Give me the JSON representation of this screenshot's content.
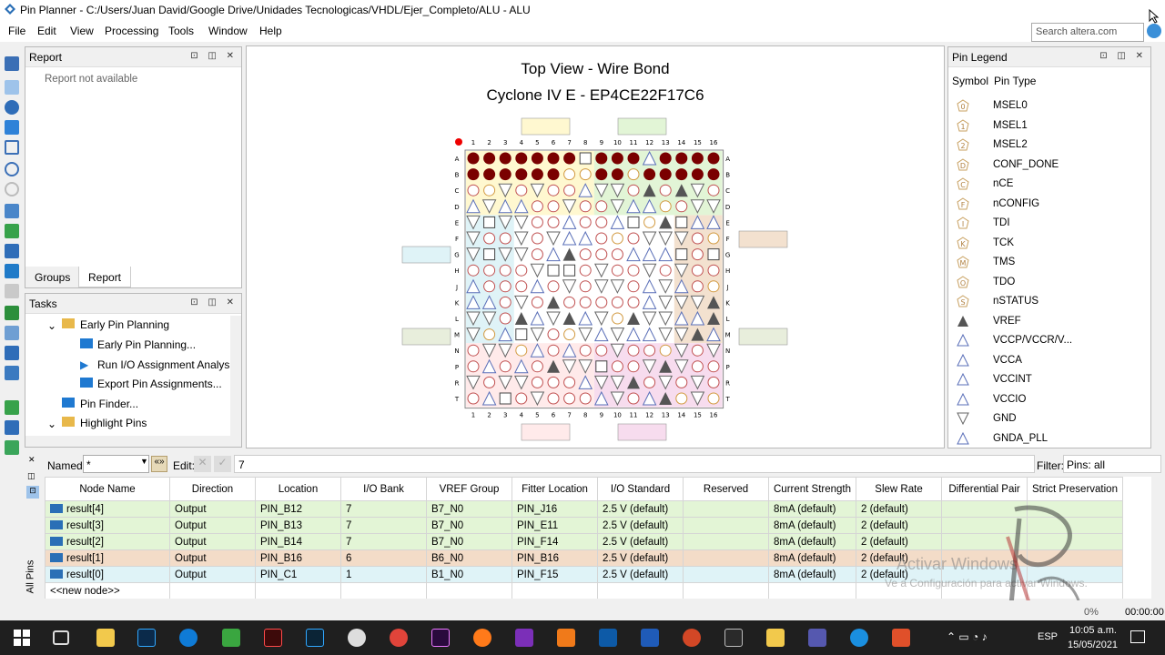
{
  "window": {
    "title": "Pin Planner - C:/Users/Juan David/Google Drive/Unidades Tecnologicas/VHDL/Ejer_Completo/ALU - ALU"
  },
  "menu": [
    "File",
    "Edit",
    "View",
    "Processing",
    "Tools",
    "Window",
    "Help"
  ],
  "search": {
    "placeholder": "Search altera.com"
  },
  "report_panel": {
    "title": "Report",
    "message": "Report not available",
    "tabs": [
      "Groups",
      "Report"
    ]
  },
  "tasks_panel": {
    "title": "Tasks",
    "items": [
      "Early Pin Planning",
      "Early Pin Planning...",
      "Run I/O Assignment Analysi",
      "Export Pin Assignments...",
      "Pin Finder...",
      "Highlight Pins"
    ]
  },
  "package_view": {
    "title": "Top View - Wire Bond",
    "device": "Cyclone IV E - EP4CE22F17C6",
    "columns": [
      "1",
      "2",
      "3",
      "4",
      "5",
      "6",
      "7",
      "8",
      "9",
      "10",
      "11",
      "12",
      "13",
      "14",
      "15",
      "16"
    ],
    "rows": [
      "A",
      "B",
      "C",
      "D",
      "E",
      "F",
      "G",
      "H",
      "J",
      "K",
      "L",
      "M",
      "N",
      "P",
      "R",
      "T"
    ]
  },
  "legend": {
    "title": "Pin Legend",
    "headers": [
      "Symbol",
      "Pin Type"
    ],
    "items": [
      {
        "name": "MSEL0",
        "glyph": "0"
      },
      {
        "name": "MSEL1",
        "glyph": "1"
      },
      {
        "name": "MSEL2",
        "glyph": "2"
      },
      {
        "name": "CONF_DONE",
        "glyph": "D"
      },
      {
        "name": "nCE",
        "glyph": "C"
      },
      {
        "name": "nCONFIG",
        "glyph": "F"
      },
      {
        "name": "TDI",
        "glyph": "I"
      },
      {
        "name": "TCK",
        "glyph": "K"
      },
      {
        "name": "TMS",
        "glyph": "M"
      },
      {
        "name": "TDO",
        "glyph": "O"
      },
      {
        "name": "nSTATUS",
        "glyph": "S"
      },
      {
        "name": "VREF",
        "glyph": ""
      },
      {
        "name": "VCCP/VCCR/V...",
        "glyph": ""
      },
      {
        "name": "VCCA",
        "glyph": ""
      },
      {
        "name": "VCCINT",
        "glyph": ""
      },
      {
        "name": "VCCIO",
        "glyph": ""
      },
      {
        "name": "GND",
        "glyph": ""
      },
      {
        "name": "GNDA_PLL",
        "glyph": ""
      }
    ]
  },
  "filter_bar": {
    "named_label": "Named:",
    "named_value": "*",
    "edit_label": "Edit:",
    "edit_value": "7",
    "filter_label": "Filter:",
    "filter_value": "Pins: all"
  },
  "pins_table": {
    "side_label": "All Pins",
    "columns": [
      "Node Name",
      "Direction",
      "Location",
      "I/O Bank",
      "VREF Group",
      "Fitter Location",
      "I/O Standard",
      "Reserved",
      "Current Strength",
      "Slew Rate",
      "Differential Pair",
      "Strict Preservation"
    ],
    "rows": [
      {
        "node": "result[4]",
        "direction": "Output",
        "location": "PIN_B12",
        "bank": "7",
        "vref": "B7_N0",
        "fitter": "PIN_J16",
        "std": "2.5 V (default)",
        "reserved": "",
        "current": "8mA (default)",
        "slew": "2 (default)",
        "color": "#e3f5d6"
      },
      {
        "node": "result[3]",
        "direction": "Output",
        "location": "PIN_B13",
        "bank": "7",
        "vref": "B7_N0",
        "fitter": "PIN_E11",
        "std": "2.5 V (default)",
        "reserved": "",
        "current": "8mA (default)",
        "slew": "2 (default)",
        "color": "#e3f5d6"
      },
      {
        "node": "result[2]",
        "direction": "Output",
        "location": "PIN_B14",
        "bank": "7",
        "vref": "B7_N0",
        "fitter": "PIN_F14",
        "std": "2.5 V (default)",
        "reserved": "",
        "current": "8mA (default)",
        "slew": "2 (default)",
        "color": "#e3f5d6"
      },
      {
        "node": "result[1]",
        "direction": "Output",
        "location": "PIN_B16",
        "bank": "6",
        "vref": "B6_N0",
        "fitter": "PIN_B16",
        "std": "2.5 V (default)",
        "reserved": "",
        "current": "8mA (default)",
        "slew": "2 (default)",
        "color": "#f3dcc8"
      },
      {
        "node": "result[0]",
        "direction": "Output",
        "location": "PIN_C1",
        "bank": "1",
        "vref": "B1_N0",
        "fitter": "PIN_F15",
        "std": "2.5 V (default)",
        "reserved": "",
        "current": "8mA (default)",
        "slew": "2 (default)",
        "color": "#dff3f7"
      }
    ],
    "new_node": "<<new node>>"
  },
  "status": {
    "progress": "0%",
    "time": "00:00:00"
  },
  "watermark": {
    "line1": "Activar Windows",
    "line2": "Ve a Configuración para activar Windows."
  },
  "taskbar": {
    "lang": "ESP",
    "clock": "10:05 a.m.",
    "date": "15/05/2021"
  },
  "colors": {
    "pin_dark": "#7a0000",
    "accent": "#0078d7"
  }
}
